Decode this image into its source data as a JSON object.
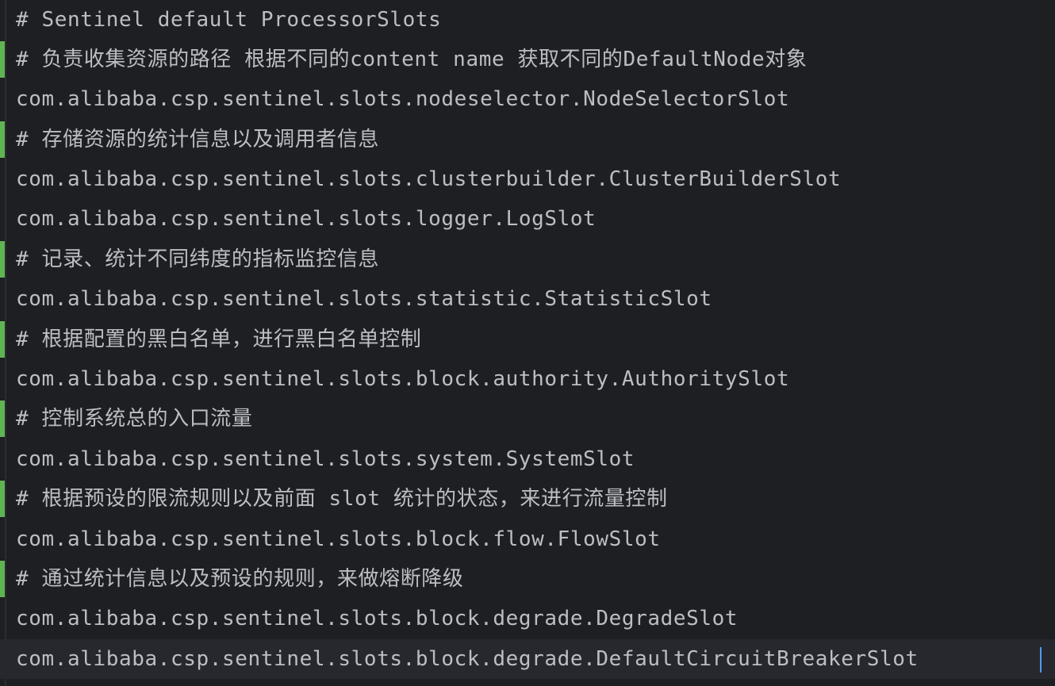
{
  "editor": {
    "lines": [
      {
        "text": "# Sentinel default ProcessorSlots",
        "type": "comment",
        "changed": false
      },
      {
        "text": "# 负责收集资源的路径 根据不同的content name 获取不同的DefaultNode对象",
        "type": "comment",
        "changed": true
      },
      {
        "text": "com.alibaba.csp.sentinel.slots.nodeselector.NodeSelectorSlot",
        "type": "code",
        "changed": false
      },
      {
        "text": "# 存储资源的统计信息以及调用者信息",
        "type": "comment",
        "changed": true
      },
      {
        "text": "com.alibaba.csp.sentinel.slots.clusterbuilder.ClusterBuilderSlot",
        "type": "code",
        "changed": false
      },
      {
        "text": "com.alibaba.csp.sentinel.slots.logger.LogSlot",
        "type": "code",
        "changed": false
      },
      {
        "text": "# 记录、统计不同纬度的指标监控信息",
        "type": "comment",
        "changed": true
      },
      {
        "text": "com.alibaba.csp.sentinel.slots.statistic.StatisticSlot",
        "type": "code",
        "changed": false
      },
      {
        "text": "# 根据配置的黑白名单，进行黑白名单控制",
        "type": "comment",
        "changed": true
      },
      {
        "text": "com.alibaba.csp.sentinel.slots.block.authority.AuthoritySlot",
        "type": "code",
        "changed": false
      },
      {
        "text": "# 控制系统总的入口流量",
        "type": "comment",
        "changed": true
      },
      {
        "text": "com.alibaba.csp.sentinel.slots.system.SystemSlot",
        "type": "code",
        "changed": false
      },
      {
        "text": "# 根据预设的限流规则以及前面 slot 统计的状态，来进行流量控制",
        "type": "comment",
        "changed": true
      },
      {
        "text": "com.alibaba.csp.sentinel.slots.block.flow.FlowSlot",
        "type": "code",
        "changed": false
      },
      {
        "text": "# 通过统计信息以及预设的规则，来做熔断降级",
        "type": "comment",
        "changed": true
      },
      {
        "text": "com.alibaba.csp.sentinel.slots.block.degrade.DegradeSlot",
        "type": "code",
        "changed": false
      },
      {
        "text": "com.alibaba.csp.sentinel.slots.block.degrade.DefaultCircuitBreakerSlot",
        "type": "code",
        "changed": false,
        "current": true
      }
    ]
  },
  "colors": {
    "background": "#1e1f22",
    "current_line": "#26282e",
    "text": "#bcbec4",
    "change_marker": "#5fb552",
    "caret": "#4a9ff5"
  }
}
